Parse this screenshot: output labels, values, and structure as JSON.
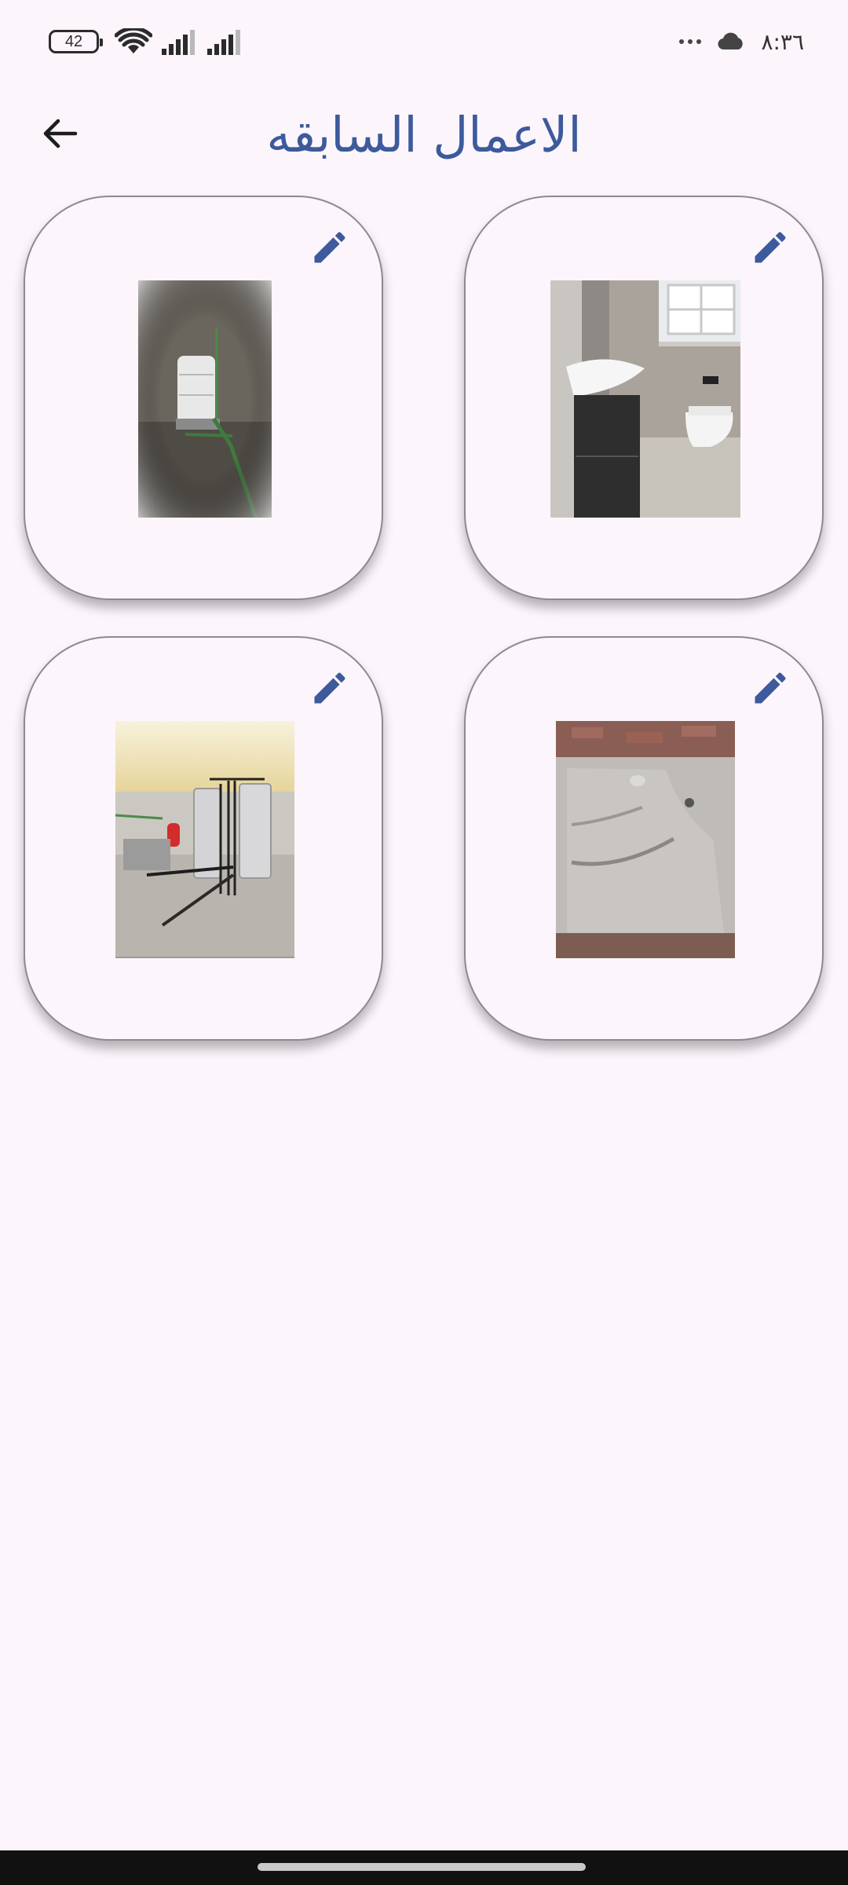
{
  "status_bar": {
    "battery": "42",
    "time": "٨:٣٦",
    "icons": [
      "battery-icon",
      "wifi-icon",
      "signal-icon",
      "signal-icon",
      "more-dots-icon",
      "cloud-icon"
    ]
  },
  "header": {
    "title": "الاعمال السابقه",
    "back_icon": "arrow-left-icon"
  },
  "works": [
    {
      "id": "work-1",
      "photo": "bathroom-vanity-toilet-photo",
      "edit_icon": "pencil-icon"
    },
    {
      "id": "work-2",
      "photo": "water-tank-room-photo",
      "edit_icon": "pencil-icon"
    },
    {
      "id": "work-3",
      "photo": "waterproofed-floor-photo",
      "edit_icon": "pencil-icon"
    },
    {
      "id": "work-4",
      "photo": "rooftop-water-tanks-photo",
      "edit_icon": "pencil-icon"
    }
  ],
  "colors": {
    "accent": "#3c5a9c",
    "background": "#fcf5fc",
    "card_border": "#8c8a8f"
  }
}
